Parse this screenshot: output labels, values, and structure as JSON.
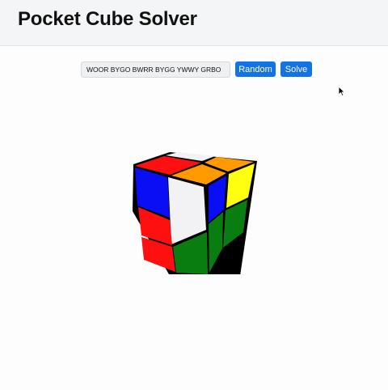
{
  "header": {
    "title": "Pocket Cube Solver"
  },
  "controls": {
    "state_value": "WOOR BYGO BWRR BYGG YWWY GRBO",
    "random_label": "Random",
    "solve_label": "Solve"
  },
  "cube": {
    "colors": {
      "white": "#f2f2f4",
      "orange": "#ff9a00",
      "red": "#ff1010",
      "blue": "#0a0ef5",
      "yellow": "#ffff10",
      "green": "#0a7d10",
      "frame": "#000000"
    },
    "faces": {
      "top": [
        "white",
        "red",
        "orange",
        "orange"
      ],
      "front": [
        "white",
        "red",
        "red",
        "green"
      ],
      "left": [
        "red",
        "blue",
        "red",
        "red"
      ],
      "right": [
        "yellow",
        "blue",
        "green",
        "green"
      ]
    }
  }
}
